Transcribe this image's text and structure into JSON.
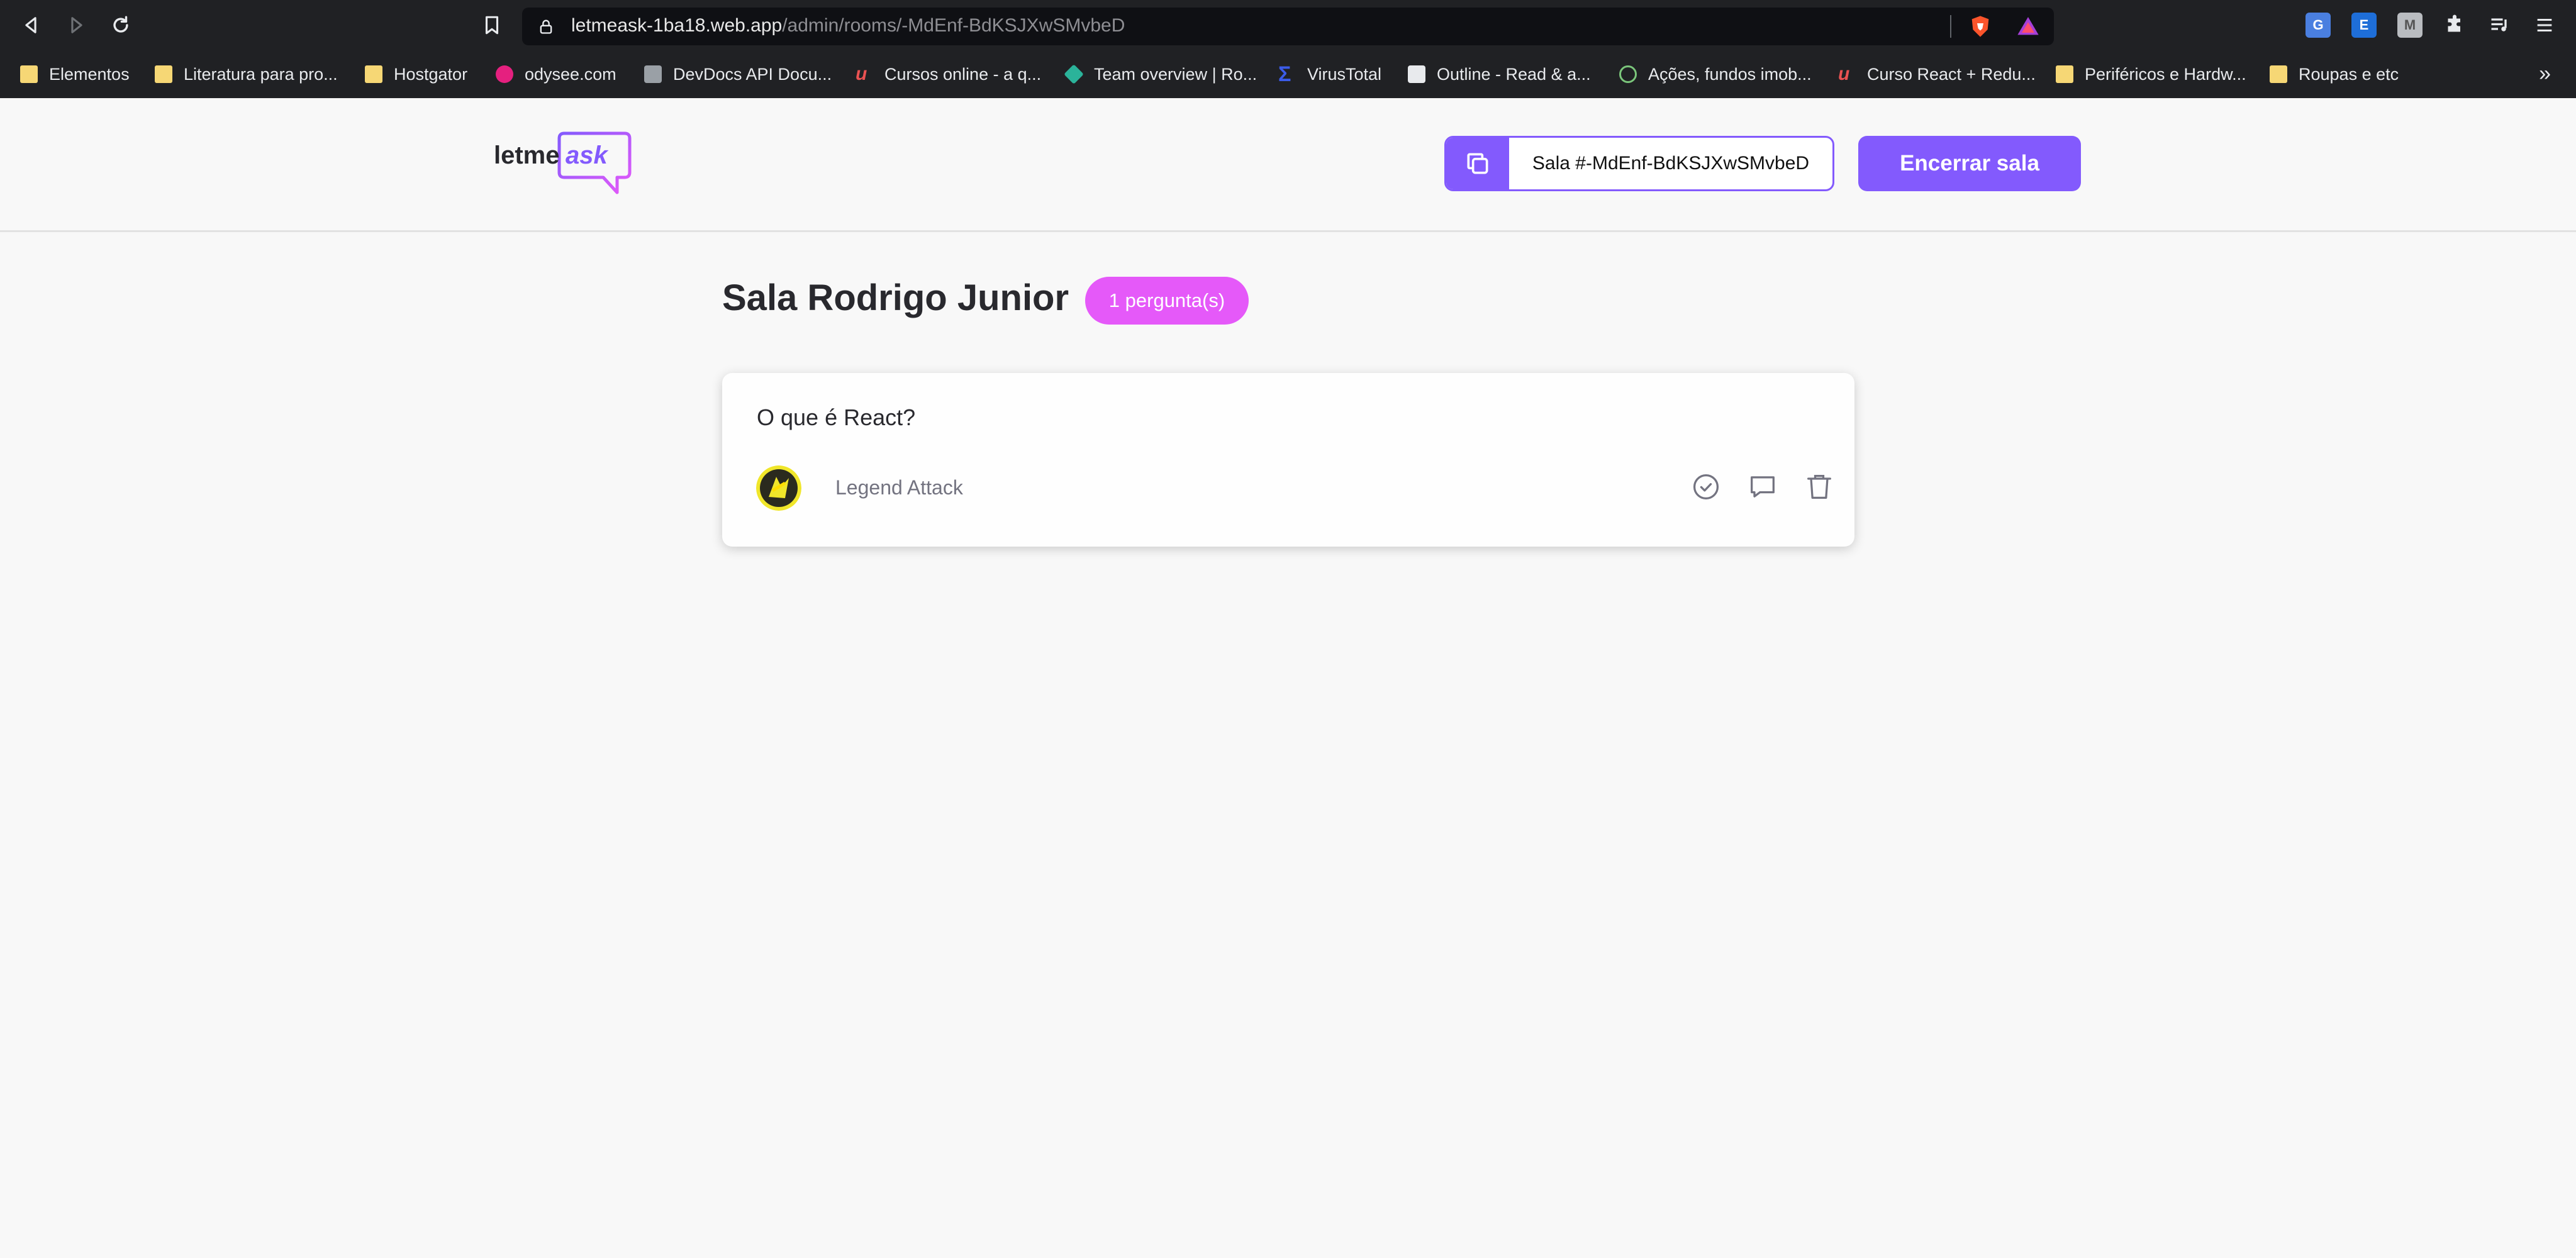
{
  "browser": {
    "url_host": "letmeask-1ba18.web.app",
    "url_path": "/admin/rooms/-MdEnf-BdKSJXwSMvbeD",
    "bookmarks": [
      {
        "label": "Elementos",
        "icon": "folder-icon",
        "color": "#f6d775"
      },
      {
        "label": "Literatura para pro...",
        "icon": "folder-icon",
        "color": "#f6d775"
      },
      {
        "label": "Hostgator",
        "icon": "folder-icon",
        "color": "#f6d775"
      },
      {
        "label": "odysee.com",
        "icon": "odysee-icon",
        "color": "#e5207f"
      },
      {
        "label": "DevDocs API Docu...",
        "icon": "devdocs-icon",
        "color": "#9aa0a6"
      },
      {
        "label": "Cursos online - a q...",
        "icon": "udemy-icon",
        "color": "#ea5252"
      },
      {
        "label": "Team overview | Ro...",
        "icon": "diamond-icon",
        "color": "#2bb39a"
      },
      {
        "label": "VirusTotal",
        "icon": "virustotal-icon",
        "color": "#3b5ce8"
      },
      {
        "label": "Outline - Read & a...",
        "icon": "outline-icon",
        "color": "#e8eaed"
      },
      {
        "label": "Ações, fundos imob...",
        "icon": "finance-icon",
        "color": "#7bc67b"
      },
      {
        "label": "Curso React + Redu...",
        "icon": "udemy-icon",
        "color": "#ea5252"
      },
      {
        "label": "Periféricos e Hardw...",
        "icon": "folder-icon",
        "color": "#f6d775"
      },
      {
        "label": "Roupas e etc",
        "icon": "folder-icon",
        "color": "#f6d775"
      }
    ],
    "bookmarks_more": "»"
  },
  "header": {
    "logo_text_plain": "letme",
    "logo_text_accent": "ask",
    "room_code_label": "Sala #-MdEnf-BdKSJXwSMvbeD",
    "close_room_label": "Encerrar sala"
  },
  "room": {
    "title": "Sala Rodrigo Junior",
    "question_count": "1 pergunta(s)"
  },
  "questions": [
    {
      "content": "O que é React?",
      "author": "Legend Attack",
      "actions": [
        "check-circle-icon",
        "answer-icon",
        "trash-icon"
      ]
    }
  ],
  "colors": {
    "primary": "#835afd",
    "badge": "#e559f9",
    "background": "#f8f8f8",
    "text": "#29292e",
    "muted": "#737380"
  }
}
